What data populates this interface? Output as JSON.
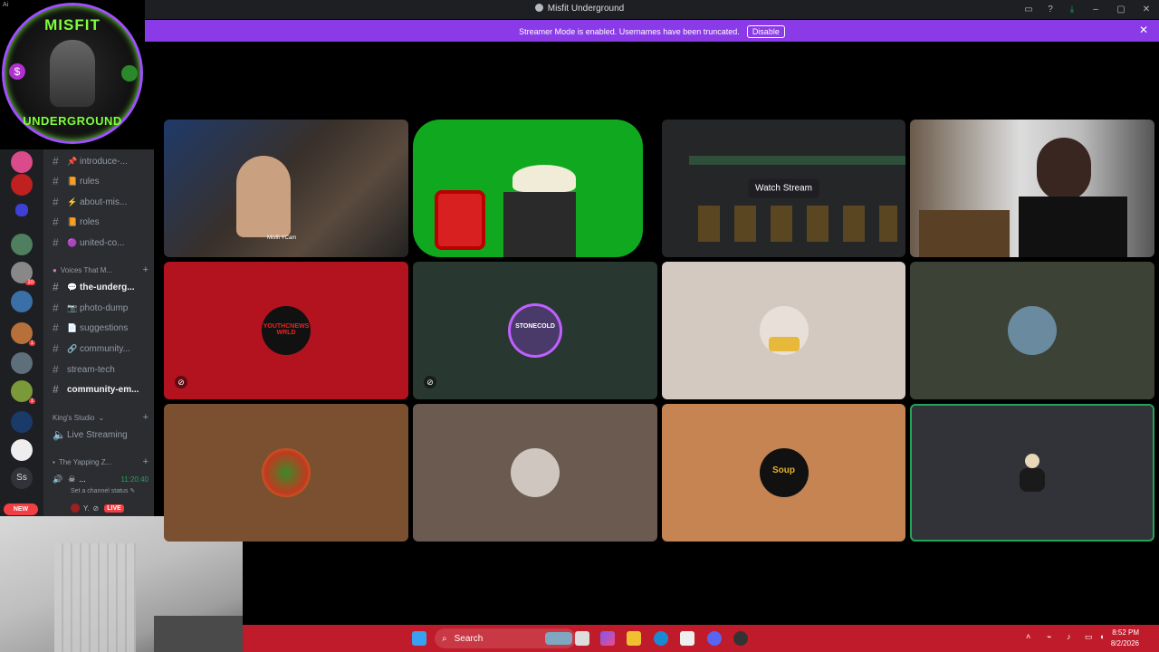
{
  "window": {
    "title": "Misfit Underground"
  },
  "banner": {
    "message": "Streamer Mode is enabled. Usernames have been truncated.",
    "disable_label": "Disable"
  },
  "logo": {
    "corner_text": "Ai",
    "line1": "MISFIT",
    "line2": "UNDERGROUND"
  },
  "guild_badges": [
    "10",
    "1",
    "1"
  ],
  "channels": {
    "items": [
      {
        "emoji": "📌",
        "label": "introduce-..."
      },
      {
        "emoji": "📙",
        "label": "rules"
      },
      {
        "emoji": "⚡",
        "label": "about-mis..."
      },
      {
        "emoji": "📙",
        "label": "roles"
      },
      {
        "emoji": "🟣",
        "label": "united-co..."
      }
    ],
    "category1": "Voices That M...",
    "items2": [
      {
        "emoji": "💬",
        "label": "the-underg..."
      },
      {
        "emoji": "📷",
        "label": "photo-dump"
      },
      {
        "emoji": "📄",
        "label": "suggestions"
      },
      {
        "emoji": "🔗",
        "label": "community..."
      },
      {
        "emoji": "",
        "label": "stream-tech"
      },
      {
        "emoji": "",
        "label": "community-em..."
      }
    ],
    "category2": "King's Studio",
    "live_streaming": "Live Streaming",
    "category3": "The Yapping Z...",
    "voice_user": "...",
    "voice_time": "11:20:40",
    "set_status": "Set a channel status",
    "stream_user": "Y.",
    "live_badge": "LIVE",
    "new_badge": "NEW",
    "guild_ss": "Ss"
  },
  "stage": {
    "watch_stream": "Watch Stream",
    "cam_label": "Misfit YCam",
    "avatars": [
      "YOUTHCNEWS WRLD",
      "STONECOLD",
      "",
      "",
      "",
      "",
      "Soup",
      ""
    ]
  },
  "taskbar": {
    "search_placeholder": "Search",
    "time": "8:52 PM",
    "date": "8/2/2026"
  }
}
